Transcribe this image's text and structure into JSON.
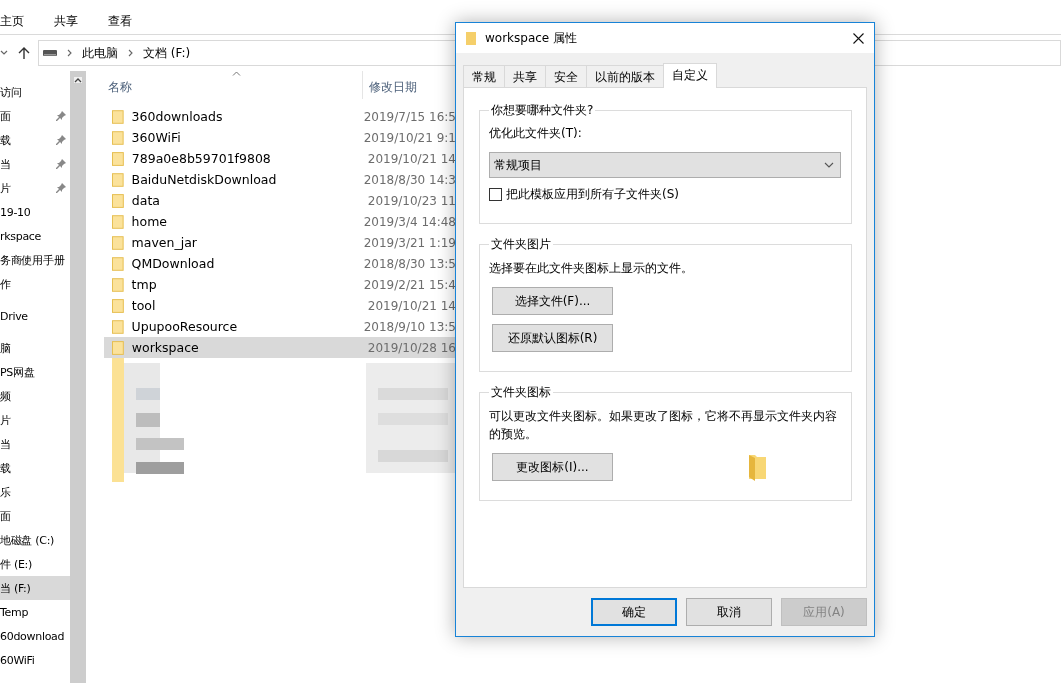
{
  "explorer": {
    "ribbon_tabs": [
      {
        "label": "主页"
      },
      {
        "label": "共享"
      },
      {
        "label": "查看"
      }
    ],
    "address": [
      "此电脑",
      "文档 (F:)"
    ],
    "nav_sections": [
      [
        {
          "label": "访问",
          "pinned": false,
          "selected": false
        },
        {
          "label": "面",
          "pinned": true,
          "selected": false
        },
        {
          "label": "载",
          "pinned": true,
          "selected": false
        },
        {
          "label": "当",
          "pinned": true,
          "selected": false
        },
        {
          "label": "片",
          "pinned": true,
          "selected": false
        },
        {
          "label": "19-10",
          "pinned": false,
          "selected": false
        },
        {
          "label": "rkspace",
          "pinned": false,
          "selected": false
        },
        {
          "label": "务商使用手册",
          "pinned": false,
          "selected": false
        },
        {
          "label": "作",
          "pinned": false,
          "selected": false
        }
      ],
      [
        {
          "label": "Drive",
          "pinned": false,
          "selected": false
        }
      ],
      [
        {
          "label": "脑",
          "pinned": false,
          "selected": false
        },
        {
          "label": "PS网盘",
          "pinned": false,
          "selected": false
        },
        {
          "label": "频",
          "pinned": false,
          "selected": false
        },
        {
          "label": "片",
          "pinned": false,
          "selected": false
        },
        {
          "label": "当",
          "pinned": false,
          "selected": false
        },
        {
          "label": "载",
          "pinned": false,
          "selected": false
        },
        {
          "label": "乐",
          "pinned": false,
          "selected": false
        },
        {
          "label": "面",
          "pinned": false,
          "selected": false
        },
        {
          "label": "地磁盘 (C:)",
          "pinned": false,
          "selected": false
        },
        {
          "label": "件 (E:)",
          "pinned": false,
          "selected": false
        },
        {
          "label": "当 (F:)",
          "pinned": false,
          "selected": true
        },
        {
          "label": "Temp",
          "pinned": false,
          "selected": false
        },
        {
          "label": "60download",
          "pinned": false,
          "selected": false
        },
        {
          "label": "60WiFi",
          "pinned": false,
          "selected": false
        }
      ]
    ],
    "columns": [
      "名称",
      "修改日期"
    ],
    "rows": [
      {
        "name": "360downloads",
        "date": "2019/7/15 16:5",
        "selected": false
      },
      {
        "name": "360WiFi",
        "date": "2019/10/21 9:1",
        "selected": false
      },
      {
        "name": "789a0e8b59701f9808",
        "date": "2019/10/21 14",
        "selected": false
      },
      {
        "name": "BaiduNetdiskDownload",
        "date": "2018/8/30 14:3",
        "selected": false
      },
      {
        "name": "data",
        "date": "2019/10/23 11",
        "selected": false
      },
      {
        "name": "home",
        "date": "2019/3/4 14:48",
        "selected": false
      },
      {
        "name": "maven_jar",
        "date": "2019/3/21 1:19",
        "selected": false
      },
      {
        "name": "QMDownload",
        "date": "2018/8/30 13:5",
        "selected": false
      },
      {
        "name": "tmp",
        "date": "2019/2/21 15:4",
        "selected": false
      },
      {
        "name": "tool",
        "date": "2019/10/21 14",
        "selected": false
      },
      {
        "name": "UpupooResource",
        "date": "2018/9/10 13:5",
        "selected": false
      },
      {
        "name": "workspace",
        "date": "2019/10/28 16",
        "selected": true
      }
    ]
  },
  "dialog": {
    "title": "workspace 属性",
    "tabs": [
      {
        "label": "常规",
        "selected": false
      },
      {
        "label": "共享",
        "selected": false
      },
      {
        "label": "安全",
        "selected": false
      },
      {
        "label": "以前的版本",
        "selected": false
      },
      {
        "label": "自定义",
        "selected": true
      }
    ],
    "groups": [
      {
        "title": "你想要哪种文件夹?",
        "items": [
          {
            "kind": "label",
            "text": "优化此文件夹(T):"
          },
          {
            "kind": "dropdown",
            "value": "常规项目"
          },
          {
            "kind": "checkbox",
            "label": "把此模板应用到所有子文件夹(S)",
            "checked": false
          }
        ]
      },
      {
        "title": "文件夹图片",
        "items": [
          {
            "kind": "text",
            "text": "选择要在此文件夹图标上显示的文件。"
          },
          {
            "kind": "button",
            "label": "选择文件(F)..."
          },
          {
            "kind": "button",
            "label": "还原默认图标(R)"
          }
        ]
      },
      {
        "title": "文件夹图标",
        "items": [
          {
            "kind": "text",
            "text": "可以更改文件夹图标。如果更改了图标，它将不再显示文件夹内容的预览。"
          },
          {
            "kind": "button_preview",
            "label": "更改图标(I)..."
          }
        ]
      }
    ],
    "buttons": [
      {
        "label": "确定",
        "default": true,
        "disabled": false
      },
      {
        "label": "取消",
        "default": false,
        "disabled": false
      },
      {
        "label": "应用(A)",
        "default": false,
        "disabled": true
      }
    ]
  }
}
